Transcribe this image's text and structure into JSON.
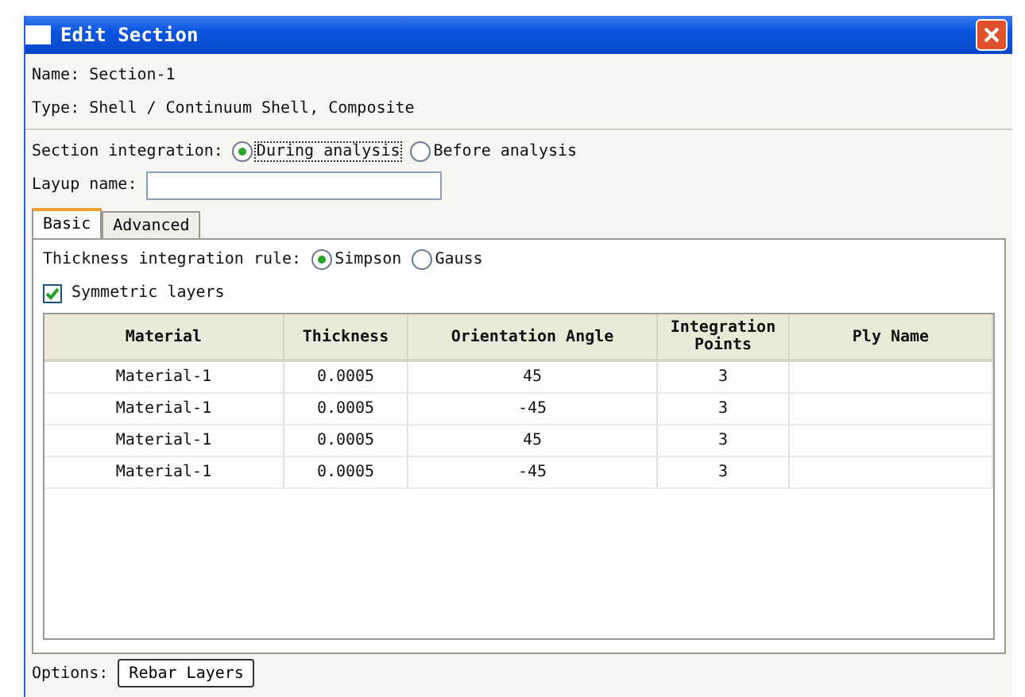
{
  "window": {
    "title": "Edit Section"
  },
  "name_line": {
    "label": "Name:",
    "value": "Section-1"
  },
  "type_line": {
    "label": "Type:",
    "value": "Shell / Continuum Shell, Composite"
  },
  "section_integration": {
    "label": "Section integration:",
    "options": [
      {
        "label": "During analysis",
        "selected": true
      },
      {
        "label": "Before analysis",
        "selected": false
      }
    ]
  },
  "layup_name": {
    "label": "Layup name:"
  },
  "tabs": [
    {
      "label": "Basic",
      "selected": true
    },
    {
      "label": "Advanced",
      "selected": false
    }
  ],
  "thickness_rule": {
    "label": "Thickness integration rule:",
    "options": [
      {
        "label": "Simpson",
        "selected": true
      },
      {
        "label": "Gauss",
        "selected": false
      }
    ]
  },
  "symmetric_layers": {
    "label": "Symmetric layers",
    "checked": true
  },
  "table": {
    "columns": [
      "Material",
      "Thickness",
      "Orientation Angle",
      "Integration Points",
      "Ply Name"
    ],
    "rows": [
      [
        "Material-1",
        "0.0005",
        "45",
        "3",
        ""
      ],
      [
        "Material-1",
        "0.0005",
        "-45",
        "3",
        ""
      ],
      [
        "Material-1",
        "0.0005",
        "45",
        "3",
        ""
      ],
      [
        "Material-1",
        "0.0005",
        "-45",
        "3",
        ""
      ]
    ]
  },
  "options": {
    "label": "Options:",
    "button": "Rebar Layers"
  }
}
